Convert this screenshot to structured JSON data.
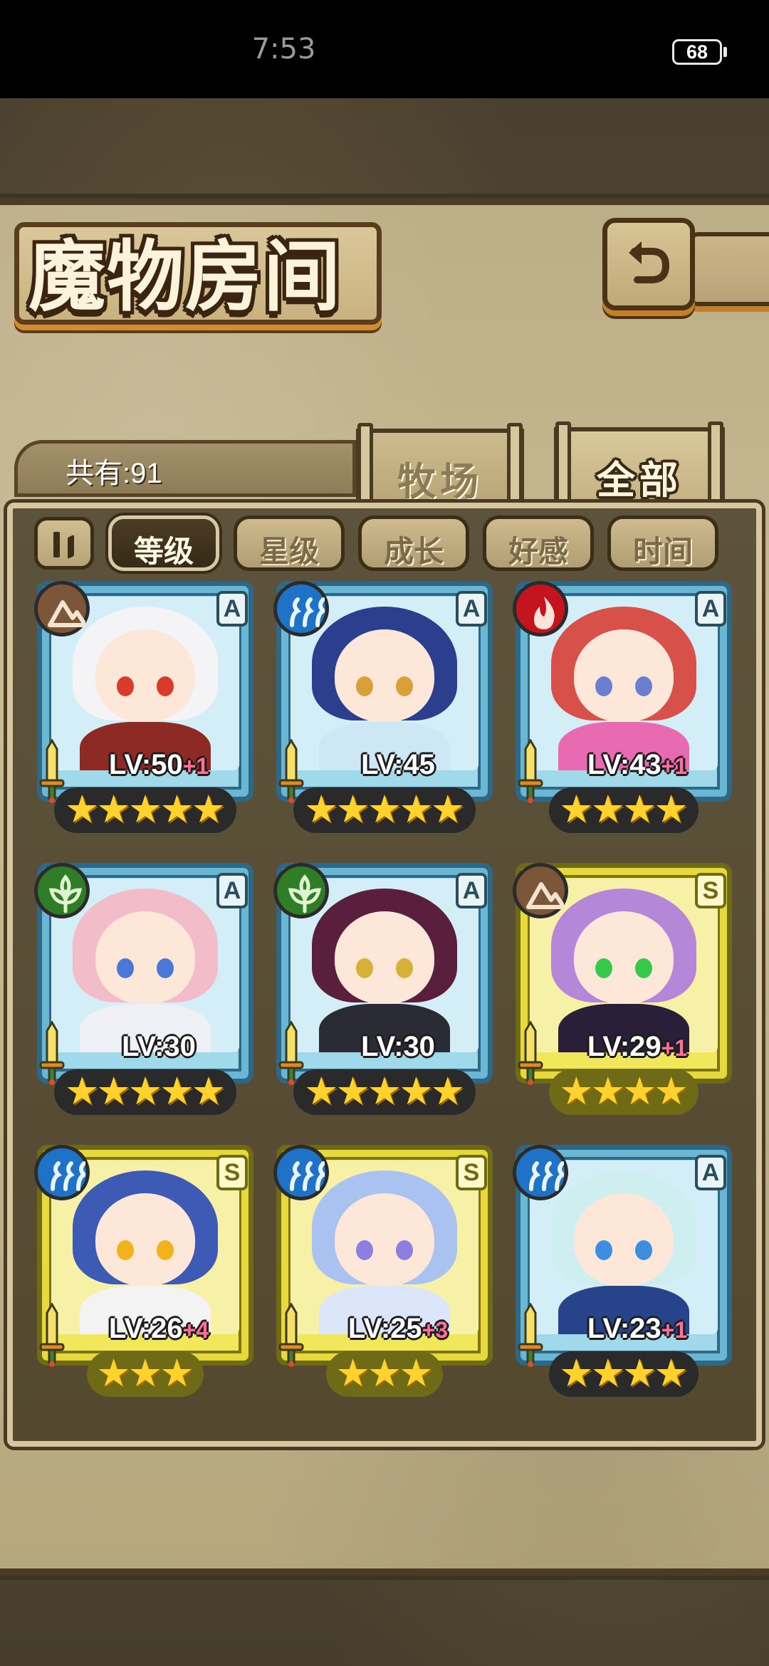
{
  "status_bar": {
    "time": "7:53",
    "battery": "68"
  },
  "header": {
    "title": "魔物房间",
    "back_icon": "back-arrow-icon"
  },
  "summary": {
    "count_label": "共有:91"
  },
  "tabs": [
    {
      "label": "牧场",
      "active": false
    },
    {
      "label": "全部",
      "active": true
    }
  ],
  "sort": {
    "toggle_icon": "sort-order-icon",
    "buttons": [
      {
        "label": "等级",
        "active": true
      },
      {
        "label": "星级",
        "active": false
      },
      {
        "label": "成长",
        "active": false
      },
      {
        "label": "好感",
        "active": false
      },
      {
        "label": "时间",
        "active": false
      }
    ]
  },
  "monsters": [
    {
      "element": "earth",
      "rank": "A",
      "level": "LV:50",
      "plus": "+1",
      "stars": 5,
      "hair": "#f4f4f7",
      "eyes": "#d93a2a",
      "body": "#8d2a24"
    },
    {
      "element": "water",
      "rank": "A",
      "level": "LV:45",
      "plus": "",
      "stars": 5,
      "hair": "#2c3f8f",
      "eyes": "#d9a038",
      "body": "#cde7f5"
    },
    {
      "element": "fire",
      "rank": "A",
      "level": "LV:43",
      "plus": "+1",
      "stars": 4,
      "hair": "#d7504a",
      "eyes": "#6a7fd0",
      "body": "#e86ab0"
    },
    {
      "element": "grass",
      "rank": "A",
      "level": "LV:30",
      "plus": "",
      "stars": 5,
      "hair": "#f2bcc8",
      "eyes": "#4a78d6",
      "body": "#eef0f5"
    },
    {
      "element": "grass",
      "rank": "A",
      "level": "LV:30",
      "plus": "",
      "stars": 5,
      "hair": "#5a1f3d",
      "eyes": "#d7b03a",
      "body": "#2b2b35"
    },
    {
      "element": "earth",
      "rank": "S",
      "level": "LV:29",
      "plus": "+1",
      "stars": 4,
      "hair": "#b487d8",
      "eyes": "#36c94b",
      "body": "#2a1f38"
    },
    {
      "element": "water",
      "rank": "S",
      "level": "LV:26",
      "plus": "+4",
      "stars": 3,
      "hair": "#3d5bb4",
      "eyes": "#f2b21b",
      "body": "#f3f3f3"
    },
    {
      "element": "water",
      "rank": "S",
      "level": "LV:25",
      "plus": "+3",
      "stars": 3,
      "hair": "#a9c2ef",
      "eyes": "#8d7fe0",
      "body": "#dce6fb"
    },
    {
      "element": "water",
      "rank": "A",
      "level": "LV:23",
      "plus": "+1",
      "stars": 4,
      "hair": "#cfeef0",
      "eyes": "#3d8ee0",
      "body": "#27448a"
    }
  ]
}
